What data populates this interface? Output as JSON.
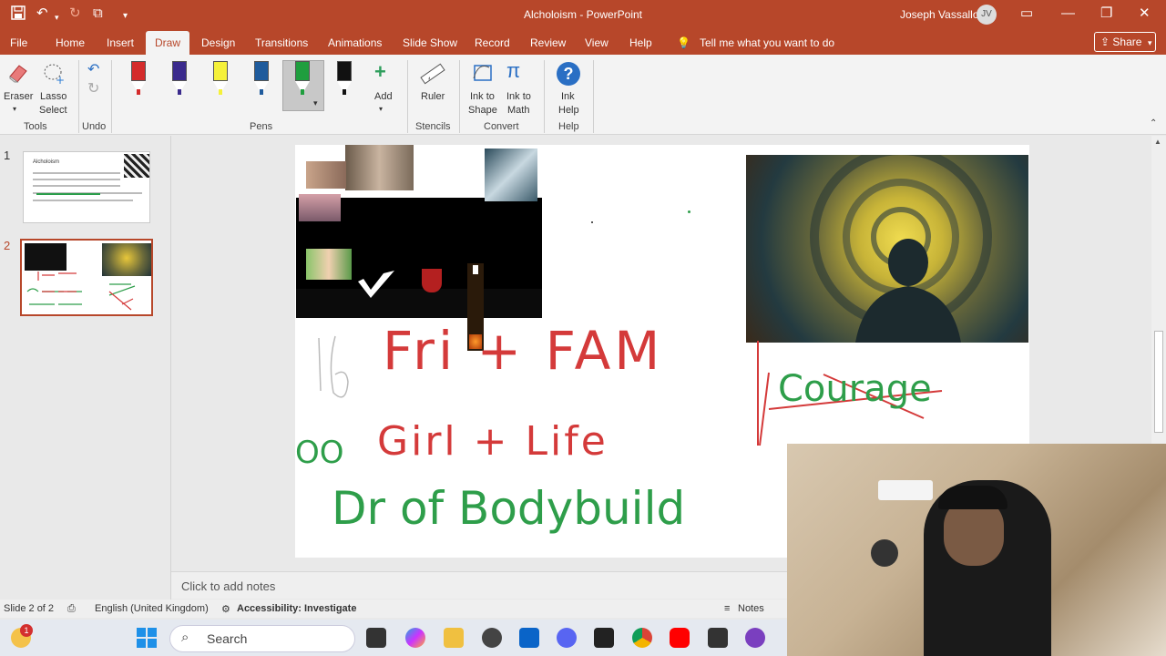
{
  "window": {
    "title": "Alcholoism - PowerPoint",
    "user_name": "Joseph Vassallo",
    "user_initials": "JV"
  },
  "menu": {
    "tabs": [
      "File",
      "Home",
      "Insert",
      "Draw",
      "Design",
      "Transitions",
      "Animations",
      "Slide Show",
      "Record",
      "Review",
      "View",
      "Help"
    ],
    "active_tab": "Draw",
    "tell_me": "Tell me what you want to do",
    "share": "Share"
  },
  "ribbon": {
    "tools": {
      "eraser": "Eraser",
      "lasso_line1": "Lasso",
      "lasso_line2": "Select",
      "group": "Tools"
    },
    "undo_group": "Undo",
    "pens": {
      "group": "Pens",
      "add": "Add",
      "colors": [
        "#d42b2b",
        "#3a2a8c",
        "#f5f13a",
        "#1f5b9c",
        "#1f9e3e",
        "#111111"
      ]
    },
    "stencils": {
      "ruler": "Ruler",
      "group": "Stencils"
    },
    "convert": {
      "ink_shape_line1": "Ink to",
      "ink_shape_line2": "Shape",
      "ink_math_line1": "Ink to",
      "ink_math_line2": "Math",
      "group": "Convert"
    },
    "help": {
      "ink_help_line1": "Ink",
      "ink_help_line2": "Help",
      "group": "Help"
    }
  },
  "slides": {
    "thumb1": {
      "number": "1",
      "title": "Alcholoism"
    },
    "thumb2": {
      "number": "2"
    }
  },
  "slide": {
    "ink": {
      "num": "16",
      "line1": "Fri + FAM",
      "line2_prefix": "OO",
      "line2": "Girl + Life",
      "line3": "Dr of Bodybuild",
      "courage": "Courage"
    }
  },
  "notes": {
    "placeholder": "Click to add notes"
  },
  "status": {
    "slide_of": "Slide 2 of 2",
    "language": "English (United Kingdom)",
    "accessibility": "Accessibility: Investigate",
    "notes": "Notes"
  },
  "taskbar": {
    "search": "Search",
    "weather_badge": "1"
  }
}
